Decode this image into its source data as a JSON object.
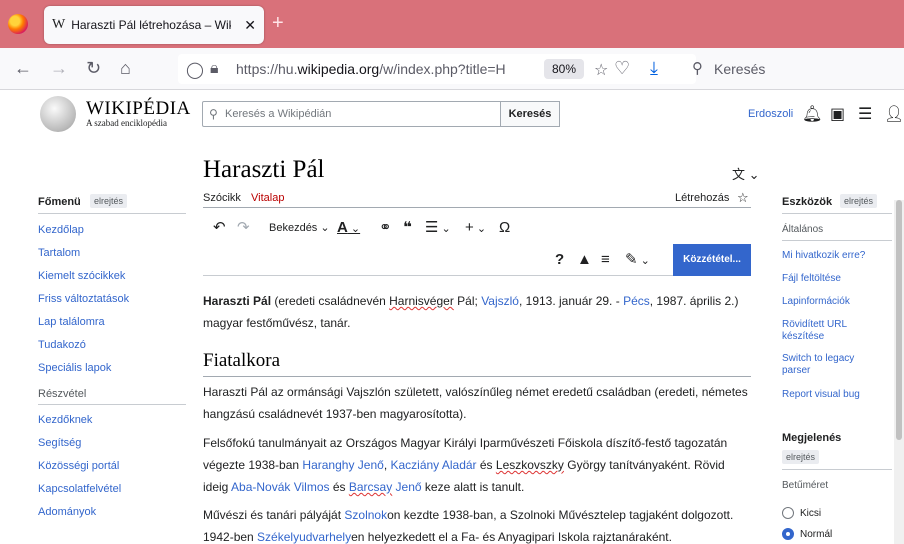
{
  "browser": {
    "tab_title": "Haraszti Pál létrehozása – Wikipédia",
    "tab_close": "✕",
    "new_tab": "+",
    "url_prefix": "https://hu.",
    "url_domain": "wikipedia.org",
    "url_rest": "/w/index.php?title=Haraszti",
    "zoom": "80%",
    "search_placeholder": "Keresés"
  },
  "wiki_header": {
    "logo_word": "WIKIPÉDIA",
    "logo_sub": "A szabad enciklopédia",
    "search_placeholder": "Keresés a Wikipédián",
    "search_button": "Keresés",
    "username": "Erdoszoli"
  },
  "left_sidebar": {
    "title": "Főmenü",
    "hide_label": "elrejtés",
    "links": [
      "Kezdőlap",
      "Tartalom",
      "Kiemelt szócikkek",
      "Friss változtatások",
      "Lap találomra",
      "Tudakozó",
      "Speciális lapok"
    ],
    "section_participation": "Részvétel",
    "participation_links": [
      "Kezdőknek",
      "Segítség",
      "Közösségi portál",
      "Kapcsolatfelvétel",
      "Adományok"
    ]
  },
  "article": {
    "title": "Haraszti Pál",
    "tab_article": "Szócikk",
    "tab_talk": "Vitalap",
    "tab_create": "Létrehozás",
    "format_label": "Bekezdés",
    "publish_button": "Közzététel...",
    "p1": {
      "name_bold": "Haraszti Pál",
      "t1": " (eredeti családnevén ",
      "spell1": "Harnisvéger",
      "t2": " Pál; ",
      "link1": "Vajszló",
      "t3": ", 1913. január 29. - ",
      "link2": "Pécs",
      "t4": ", 1987. április 2.)",
      "line2": "magyar festőművész, tanár."
    },
    "section_heading": "Fiatalkora",
    "p2_line1": "Haraszti Pál az ormánsági Vajszlón született, valószínűleg német eredetű családban (eredeti, németes",
    "p2_line2": "hangzású családnevét 1937-ben magyarosította).",
    "p3": {
      "l1": "Felsőfokú tanulmányait az Országos Magyar Királyi Iparművészeti Főiskola díszítő-festő tagozatán",
      "l2a": "végezte 1938-ban ",
      "l2_link1": "Haranghy Jenő",
      "l2b": ", ",
      "l2_link2": "Kacziány Aladár",
      "l2c": " és ",
      "l2_spell": "Leszkovszky",
      "l2d": " György tanítványaként. Rövid",
      "l3a": "ideig ",
      "l3_link1": "Aba-Novák Vilmos",
      "l3b": " és ",
      "l3_link2a": "Barcsay",
      "l3_link2b": " Jenő",
      "l3c": " keze alatt is tanult."
    },
    "p4": {
      "l1a": "Művészi és tanári pályáját ",
      "l1_link": "Szolnok",
      "l1b": "on kezdte 1938-ban, a Szolnoki Művésztelep tagjaként dolgozott.",
      "l2a": "1942-ben ",
      "l2_link": "Székelyudvarhely",
      "l2b": "en helyezkedett el a Fa- és Anyagipari Iskola rajztanáraként."
    }
  },
  "right_sidebar": {
    "tools_title": "Eszközök",
    "tools_hide": "elrejtés",
    "general_head": "Általános",
    "links": [
      "Mi hivatkozik erre?",
      "Fájl feltöltése",
      "Lapinformációk",
      "Rövidített URL készítése",
      "Switch to legacy parser",
      "Report visual bug"
    ],
    "appearance_title": "Megjelenés",
    "appearance_hide": "elrejtés",
    "font_size_head": "Betűméret",
    "radio_small": "Kicsi",
    "radio_normal": "Normál"
  }
}
